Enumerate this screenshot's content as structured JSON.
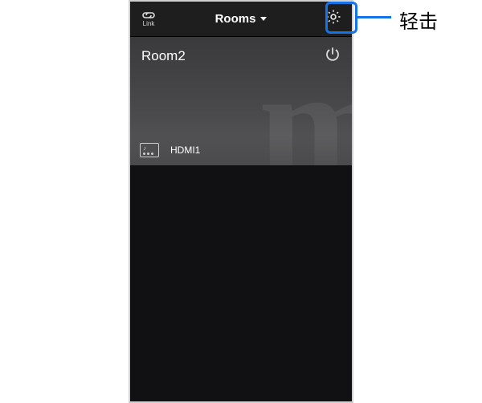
{
  "header": {
    "link_label": "Link",
    "title": "Rooms"
  },
  "room": {
    "name": "Room2",
    "source_label": "HDMI1",
    "bg_letter": "m"
  },
  "callout": {
    "label": "轻击"
  }
}
